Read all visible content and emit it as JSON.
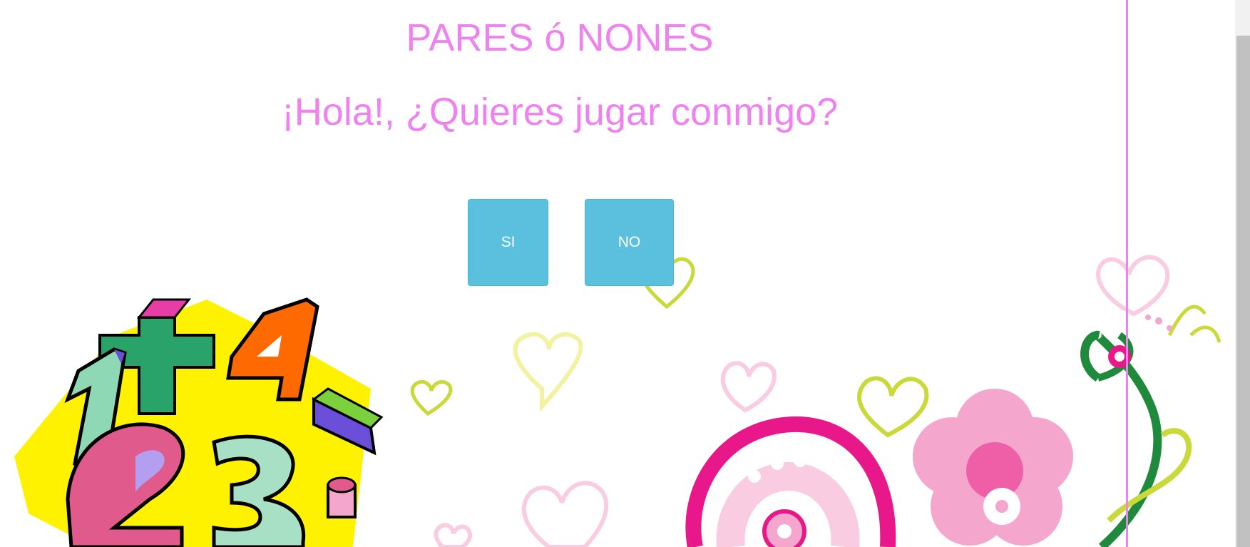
{
  "header": {
    "title": "PARES ó NONES",
    "greeting": "¡Hola!, ¿Quieres jugar conmigo?"
  },
  "buttons": {
    "yes_label": "SI",
    "no_label": "NO"
  },
  "colors": {
    "title": "#ee82ee",
    "button_bg": "#5bc0de",
    "button_border": "#46b8da",
    "divider": "#ee82ee",
    "magenta": "#e8188a",
    "pink": "#f4a6cd",
    "light_pink": "#f9cce2",
    "lime": "#c9d93a",
    "pale_yellow": "#f3f2a0",
    "green": "#1f8a3c",
    "yellow": "#fff200",
    "mint": "#8fd8b5",
    "number_green": "#2aa36a",
    "number_orange": "#ff6a00",
    "number_purple": "#6b4fd8",
    "number_pink": "#e05a8c",
    "lavender": "#b39ef0"
  },
  "decoration": {
    "illustration_left": "colorful-numbers-clipart",
    "illustration_right": "floral-hearts-swirls-background"
  }
}
